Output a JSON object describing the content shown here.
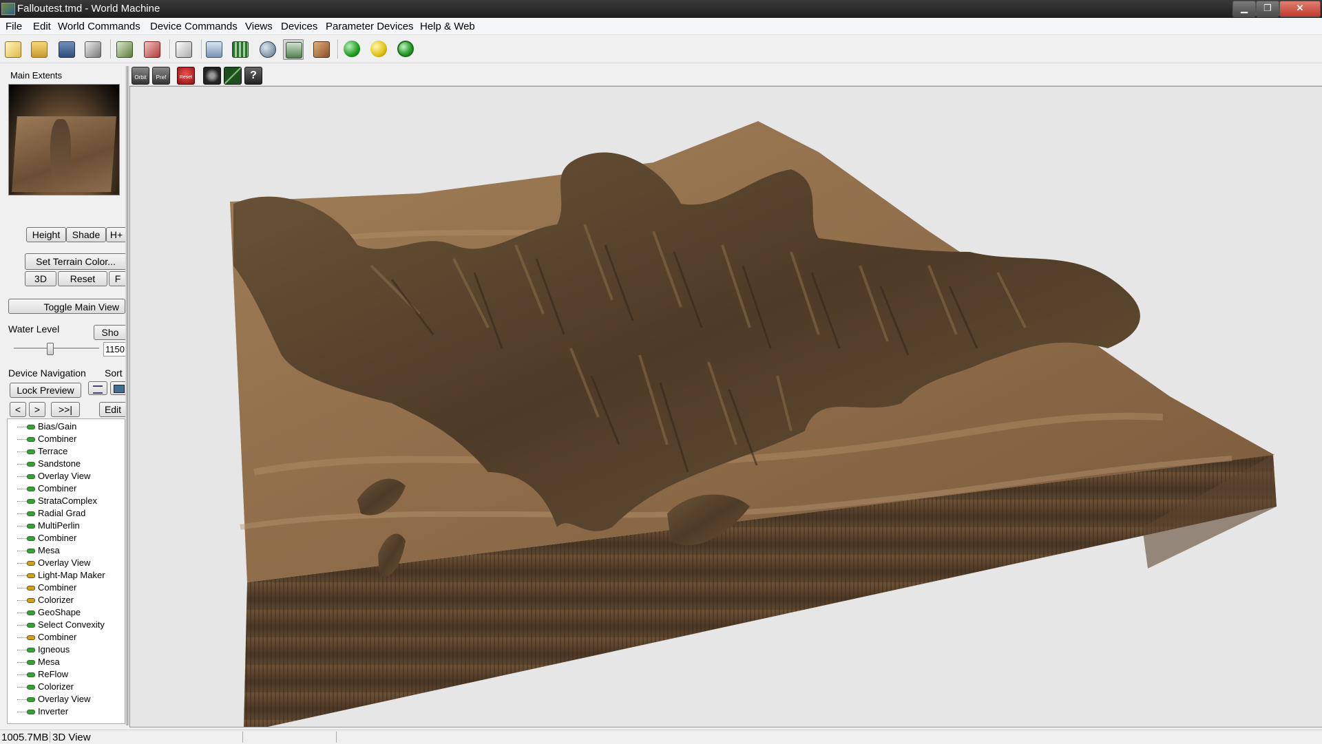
{
  "window": {
    "title": "Falloutest.tmd - World Machine",
    "min_label": "▁",
    "max_label": "❐",
    "close_label": "✕"
  },
  "menu": {
    "items": [
      "File",
      "Edit",
      "World Commands",
      "Device Commands",
      "Views",
      "Devices",
      "Parameter Devices",
      "Help & Web"
    ]
  },
  "toolbar": {
    "icons": [
      "new-file-icon",
      "open-folder-icon",
      "save-disk-icon",
      "wand-icon",
      "import-icon",
      "export-icon",
      "dice-icon",
      "layout-icon",
      "grid-icon",
      "globe-icon",
      "terrain-view-icon",
      "texture-icon",
      "build-green-icon",
      "build-yellow-icon",
      "build-region-icon"
    ]
  },
  "view_toolbar": {
    "icons": [
      "orbit-icon",
      "pref-icon",
      "reset-icon",
      "camera-icon",
      "line-icon",
      "help-icon"
    ],
    "orbit_text": "Orbit",
    "pref_text": "Pref",
    "reset_text": "Reset",
    "help_text": "?"
  },
  "left_panel": {
    "main_extents_label": "Main Extents",
    "height_label": "Height",
    "shade_label": "Shade",
    "h_label": "H+",
    "set_terrain_color_label": "Set Terrain Color...",
    "3d_label": "3D",
    "reset_label": "Reset",
    "f_label": "F",
    "toggle_main_view_label": "Toggle Main View",
    "water_level_label": "Water Level",
    "show_label": "Sho",
    "water_level_value": "1150",
    "device_navigation_label": "Device Navigation",
    "sort_label": "Sort",
    "lock_preview_label": "Lock Preview",
    "prev_label": "<",
    "next_label": ">",
    "end_label": ">>|",
    "edit_label": "Edit"
  },
  "devices": [
    {
      "name": "Bias/Gain",
      "color": "#2fa52f"
    },
    {
      "name": "Combiner",
      "color": "#2fa52f"
    },
    {
      "name": "Terrace",
      "color": "#2fa52f"
    },
    {
      "name": "Sandstone",
      "color": "#2fa52f"
    },
    {
      "name": "Overlay View",
      "color": "#2fa52f"
    },
    {
      "name": "Combiner",
      "color": "#2fa52f"
    },
    {
      "name": "StrataComplex",
      "color": "#2fa52f"
    },
    {
      "name": "Radial Grad",
      "color": "#2fa52f"
    },
    {
      "name": "MultiPerlin",
      "color": "#2fa52f"
    },
    {
      "name": "Combiner",
      "color": "#2fa52f"
    },
    {
      "name": "Mesa",
      "color": "#2fa52f"
    },
    {
      "name": "Overlay View",
      "color": "#d4a017"
    },
    {
      "name": "Light-Map Maker",
      "color": "#d4a017"
    },
    {
      "name": "Combiner",
      "color": "#d4a017"
    },
    {
      "name": "Colorizer",
      "color": "#d4a017"
    },
    {
      "name": "GeoShape",
      "color": "#2fa52f"
    },
    {
      "name": "Select Convexity",
      "color": "#2fa52f"
    },
    {
      "name": "Combiner",
      "color": "#d4a017"
    },
    {
      "name": "Igneous",
      "color": "#2fa52f"
    },
    {
      "name": "Mesa",
      "color": "#2fa52f"
    },
    {
      "name": "ReFlow",
      "color": "#2fa52f"
    },
    {
      "name": "Colorizer",
      "color": "#2fa52f"
    },
    {
      "name": "Overlay View",
      "color": "#2fa52f"
    },
    {
      "name": "Inverter",
      "color": "#2fa52f"
    }
  ],
  "status": {
    "memory": "1005.7MB",
    "view": "3D View"
  }
}
